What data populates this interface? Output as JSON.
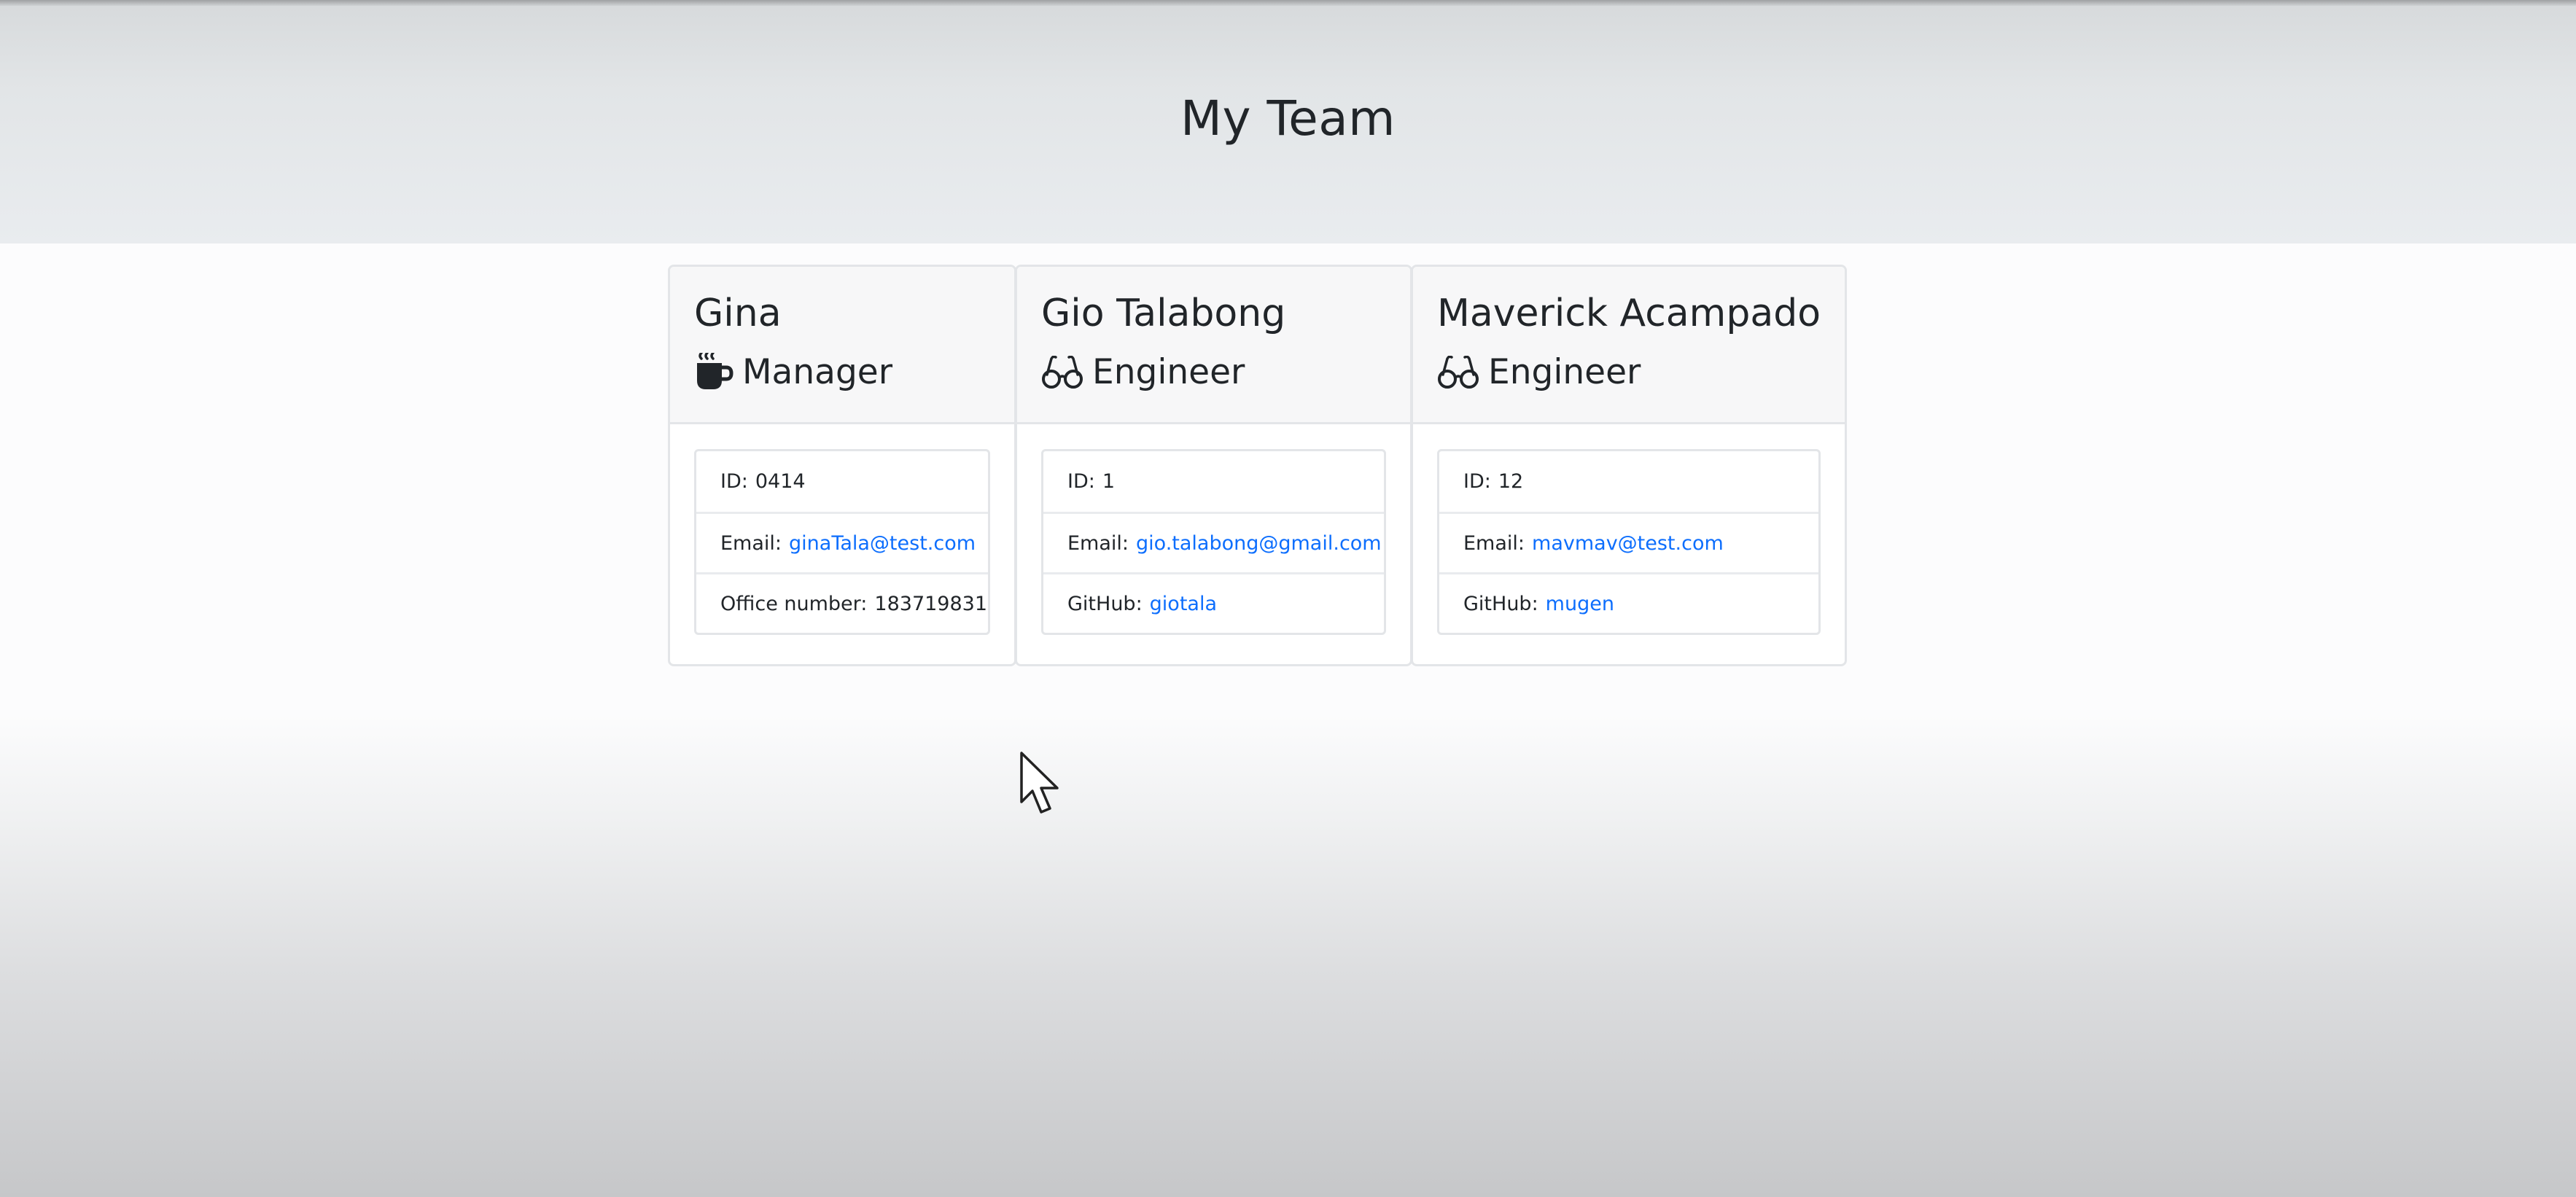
{
  "page": {
    "title": "My Team"
  },
  "colors": {
    "link": "#0d6efd",
    "text": "#212529",
    "header_bg": "#e9ecef",
    "card_header_bg": "#f7f7f8",
    "border": "#e3e5e8"
  },
  "team": [
    {
      "name": "Gina",
      "role": "Manager",
      "role_icon": "coffee-mug-icon",
      "id_label": "ID:",
      "id": "0414",
      "email_label": "Email:",
      "email": "ginaTala@test.com",
      "extra_label": "Office number:",
      "extra_value": "183719831"
    },
    {
      "name": "Gio Talabong",
      "role": "Engineer",
      "role_icon": "glasses-icon",
      "id_label": "ID:",
      "id": "1",
      "email_label": "Email:",
      "email": "gio.talabong@gmail.com",
      "extra_label": "GitHub:",
      "extra_value": "giotala"
    },
    {
      "name": "Maverick Acampado",
      "role": "Engineer",
      "role_icon": "glasses-icon",
      "id_label": "ID:",
      "id": "12",
      "email_label": "Email:",
      "email": "mavmav@test.com",
      "extra_label": "GitHub:",
      "extra_value": "mugen"
    }
  ]
}
